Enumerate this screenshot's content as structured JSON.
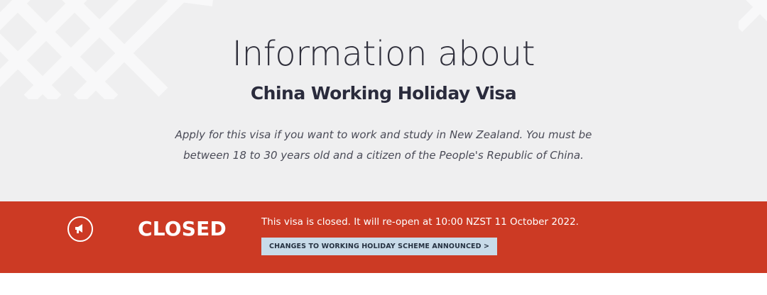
{
  "hero": {
    "title": "Information about",
    "subtitle": "China Working Holiday Visa",
    "description": "Apply for this visa if you want to work and study in New Zealand. You must be between 18 to 30 years old and a citizen of the People's Republic of China."
  },
  "status_banner": {
    "icon": "megaphone-icon",
    "status_label": "CLOSED",
    "message": "This visa is closed. It will re-open at 10:00 NZST 11 October 2022.",
    "link_label": "CHANGES TO WORKING HOLIDAY SCHEME ANNOUNCED >",
    "colors": {
      "banner_bg": "#cc3a24",
      "button_bg": "#c8dbe9",
      "hero_bg": "#efeff0"
    }
  }
}
